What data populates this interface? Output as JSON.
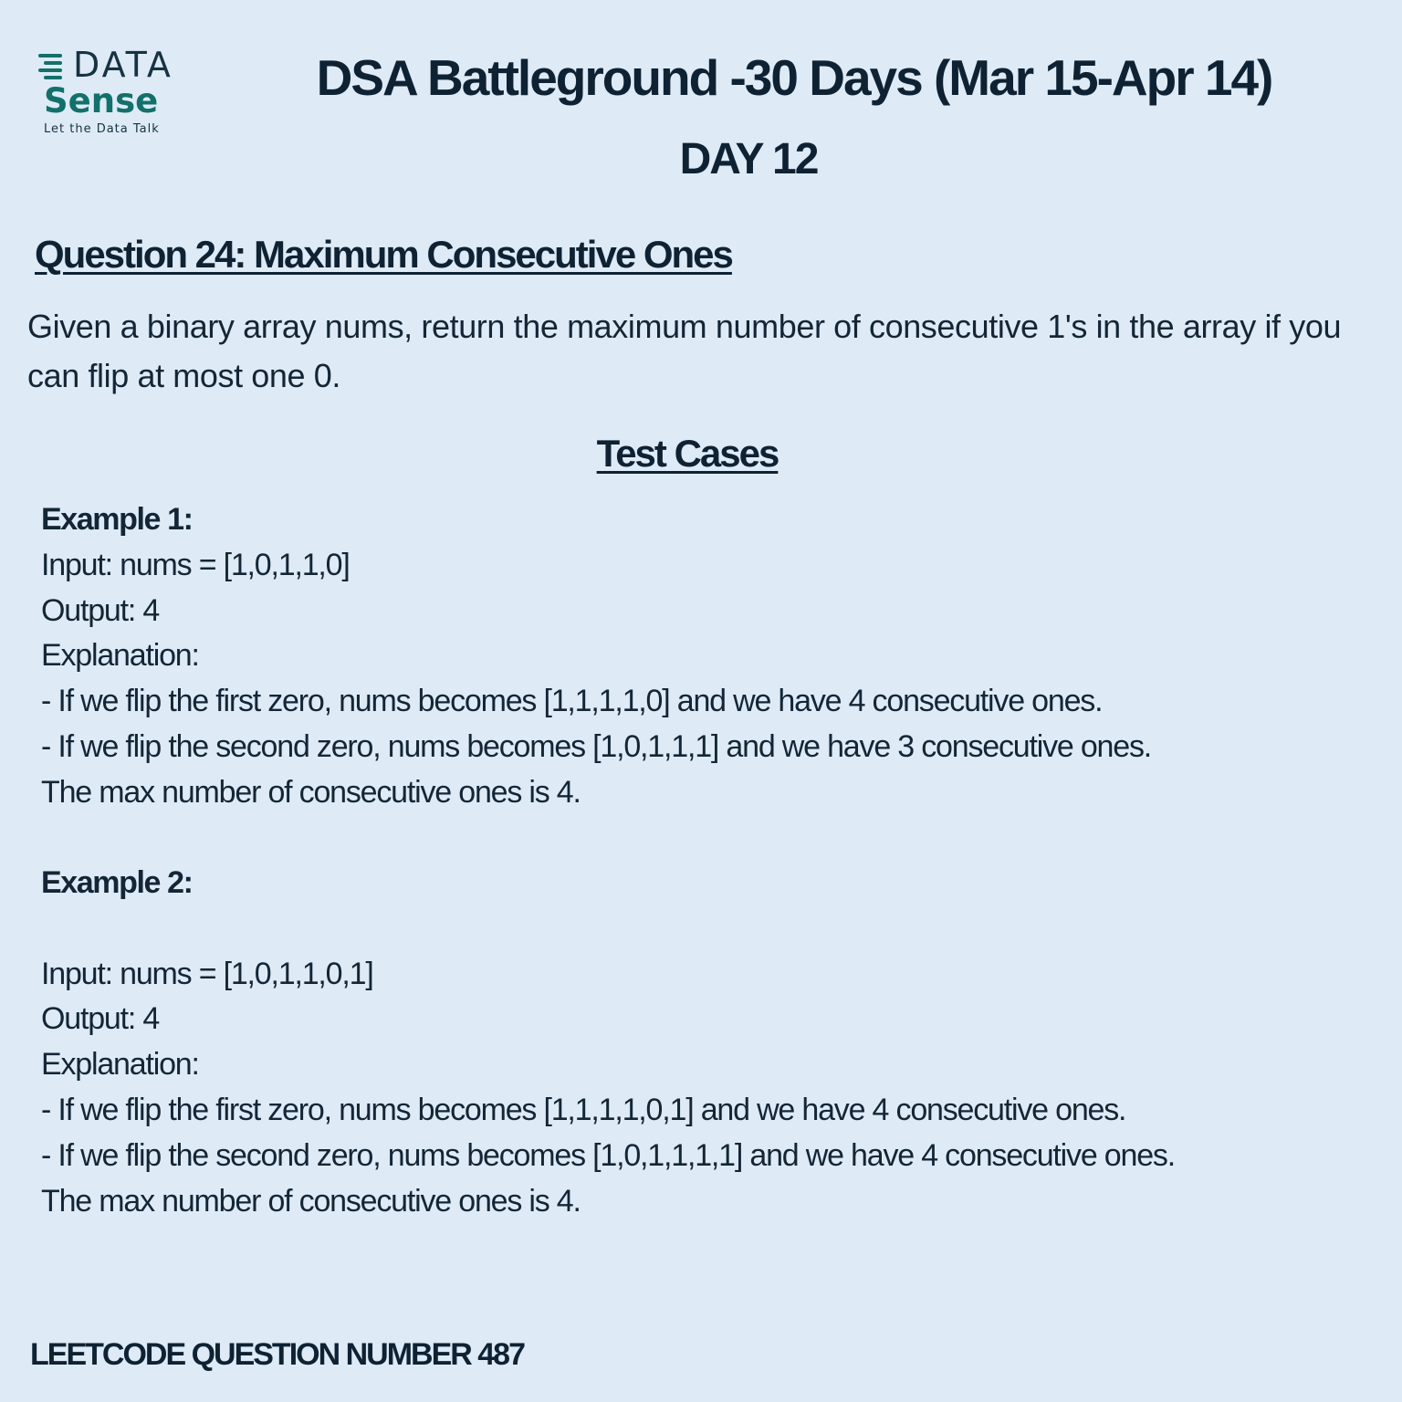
{
  "logo": {
    "brand_top": "DATA",
    "brand_bottom": "Sense",
    "tagline": "Let the Data Talk",
    "colors": {
      "dark": "#173242",
      "teal": "#13706b"
    }
  },
  "header": {
    "title": "DSA Battleground -30 Days (Mar 15-Apr 14)",
    "day": "DAY 12"
  },
  "question": {
    "heading": "Question 24: Maximum Consecutive Ones",
    "description": "Given a binary array nums, return the maximum number of consecutive 1's in the array if you can flip at most one 0."
  },
  "test_cases": {
    "heading": "Test Cases",
    "examples": [
      {
        "heading": "Example 1:",
        "input": "Input: nums = [1,0,1,1,0]",
        "output": "Output: 4",
        "explanation_label": "Explanation:",
        "explanation_lines": [
          "- If we flip the first zero, nums becomes [1,1,1,1,0] and we have 4 consecutive ones.",
          "- If we flip the second zero, nums becomes [1,0,1,1,1] and we have 3 consecutive ones.",
          "The max number of consecutive ones is 4."
        ]
      },
      {
        "heading": "Example 2:",
        "input": "Input: nums = [1,0,1,1,0,1]",
        "output": "Output: 4",
        "explanation_label": "Explanation:",
        "explanation_lines": [
          "- If we flip the first zero, nums becomes [1,1,1,1,0,1] and we have 4 consecutive ones.",
          "- If we flip the second zero, nums becomes [1,0,1,1,1,1] and we have 4 consecutive ones.",
          "The max number of consecutive ones is 4."
        ]
      }
    ]
  },
  "footer": {
    "text": "LEETCODE QUESTION NUMBER 487"
  },
  "colors": {
    "background": "#deebf7",
    "text": "#0f2233"
  }
}
